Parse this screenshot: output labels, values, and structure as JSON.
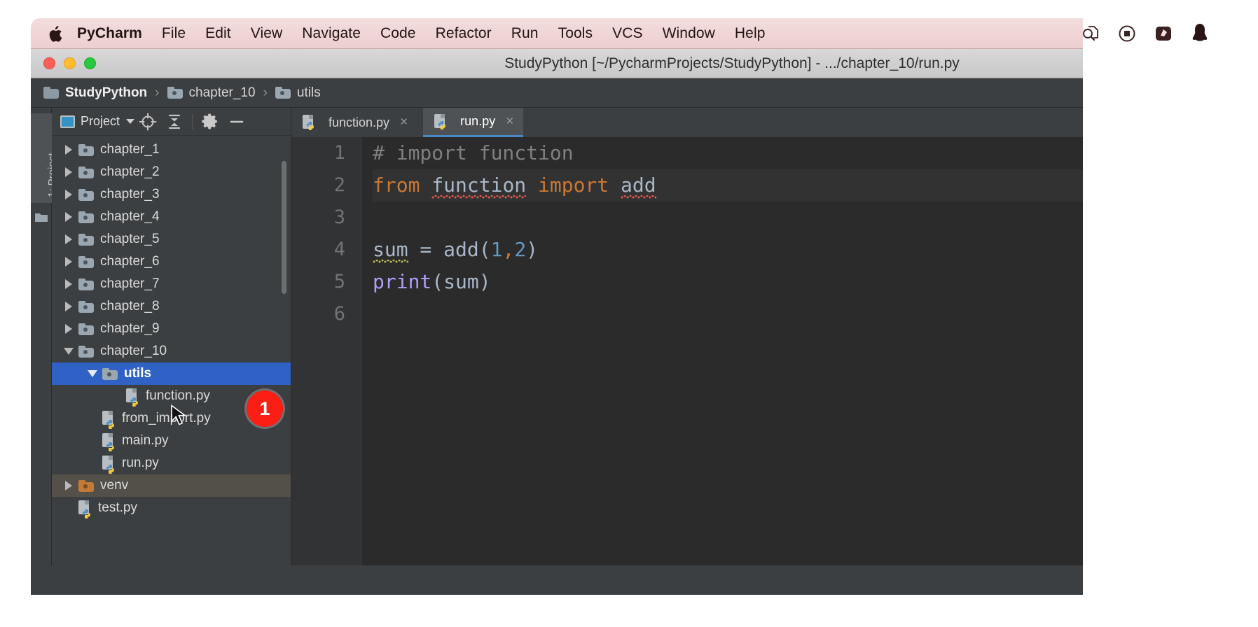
{
  "menubar": {
    "apple_icon": "apple-logo",
    "items": [
      "PyCharm",
      "File",
      "Edit",
      "View",
      "Navigate",
      "Code",
      "Refactor",
      "Run",
      "Tools",
      "VCS",
      "Window",
      "Help"
    ],
    "status_icons": [
      "search-document-icon",
      "record-circle-icon",
      "screenshot-tool-icon",
      "penguin-icon"
    ]
  },
  "window": {
    "title": "StudyPython [~/PycharmProjects/StudyPython] - .../chapter_10/run.py",
    "traffic_lights": [
      "close",
      "minimize",
      "zoom"
    ]
  },
  "breadcrumb": {
    "items": [
      {
        "label": "StudyPython",
        "icon": "folder-icon"
      },
      {
        "label": "chapter_10",
        "icon": "folder-icon"
      },
      {
        "label": "utils",
        "icon": "folder-icon"
      }
    ],
    "separator": "›"
  },
  "left_strip": {
    "tab_label": "1: Project"
  },
  "project_panel": {
    "title": "Project",
    "toolbar_icons": [
      "locate-target-icon",
      "collapse-all-icon",
      "gear-icon",
      "hide-minus-icon"
    ],
    "tree": [
      {
        "label": "chapter_1",
        "type": "folder",
        "indent": 1,
        "state": "collapsed"
      },
      {
        "label": "chapter_2",
        "type": "folder",
        "indent": 1,
        "state": "collapsed"
      },
      {
        "label": "chapter_3",
        "type": "folder",
        "indent": 1,
        "state": "collapsed"
      },
      {
        "label": "chapter_4",
        "type": "folder",
        "indent": 1,
        "state": "collapsed"
      },
      {
        "label": "chapter_5",
        "type": "folder",
        "indent": 1,
        "state": "collapsed"
      },
      {
        "label": "chapter_6",
        "type": "folder",
        "indent": 1,
        "state": "collapsed"
      },
      {
        "label": "chapter_7",
        "type": "folder",
        "indent": 1,
        "state": "collapsed"
      },
      {
        "label": "chapter_8",
        "type": "folder",
        "indent": 1,
        "state": "collapsed"
      },
      {
        "label": "chapter_9",
        "type": "folder",
        "indent": 1,
        "state": "collapsed"
      },
      {
        "label": "chapter_10",
        "type": "folder",
        "indent": 1,
        "state": "expanded"
      },
      {
        "label": "utils",
        "type": "folder",
        "indent": 2,
        "state": "expanded",
        "selected": true
      },
      {
        "label": "function.py",
        "type": "python",
        "indent": 3
      },
      {
        "label": "from_import.py",
        "type": "python",
        "indent": 2
      },
      {
        "label": "main.py",
        "type": "python",
        "indent": 2
      },
      {
        "label": "run.py",
        "type": "python",
        "indent": 2
      },
      {
        "label": "venv",
        "type": "folder-venv",
        "indent": 1,
        "state": "collapsed"
      },
      {
        "label": "test.py",
        "type": "python",
        "indent": 1
      }
    ]
  },
  "editor": {
    "tabs": [
      {
        "label": "function.py",
        "icon": "python-file-icon",
        "close": "×",
        "active": false
      },
      {
        "label": "run.py",
        "icon": "python-file-icon",
        "close": "×",
        "active": true
      }
    ],
    "line_numbers": [
      "1",
      "2",
      "3",
      "4",
      "5",
      "6"
    ],
    "lines": [
      {
        "n": "1",
        "highlight": false,
        "tokens": [
          {
            "t": "# import function",
            "cls": "tok-comment"
          }
        ]
      },
      {
        "n": "2",
        "highlight": true,
        "tokens": [
          {
            "t": "from ",
            "cls": "tok-kw"
          },
          {
            "t": "function",
            "cls": "tok-plain sq-red"
          },
          {
            "t": " ",
            "cls": "tok-plain"
          },
          {
            "t": "import ",
            "cls": "tok-kw"
          },
          {
            "t": "add",
            "cls": "tok-plain sq-red"
          }
        ]
      },
      {
        "n": "3",
        "highlight": false,
        "tokens": []
      },
      {
        "n": "4",
        "highlight": false,
        "tokens": [
          {
            "t": "sum",
            "cls": "tok-plain sq-yel"
          },
          {
            "t": " = add(",
            "cls": "tok-plain"
          },
          {
            "t": "1",
            "cls": "tok-num"
          },
          {
            "t": ",",
            "cls": "tok-kw"
          },
          {
            "t": "2",
            "cls": "tok-num"
          },
          {
            "t": ")",
            "cls": "tok-plain"
          }
        ]
      },
      {
        "n": "5",
        "highlight": false,
        "tokens": [
          {
            "t": "print",
            "cls": "tok-func"
          },
          {
            "t": "(sum)",
            "cls": "tok-plain"
          }
        ]
      },
      {
        "n": "6",
        "highlight": false,
        "tokens": []
      }
    ]
  },
  "annotation": {
    "badge_number": "1",
    "badge_color": "#fa1e14",
    "cursor": "mouse-pointer"
  },
  "colors": {
    "menubar_tint": "#f0d5d5",
    "window_chrome": "#3c3f41",
    "editor_bg": "#2b2b2b",
    "selection_blue": "#2f62c4",
    "tab_accent": "#4a88c7"
  }
}
